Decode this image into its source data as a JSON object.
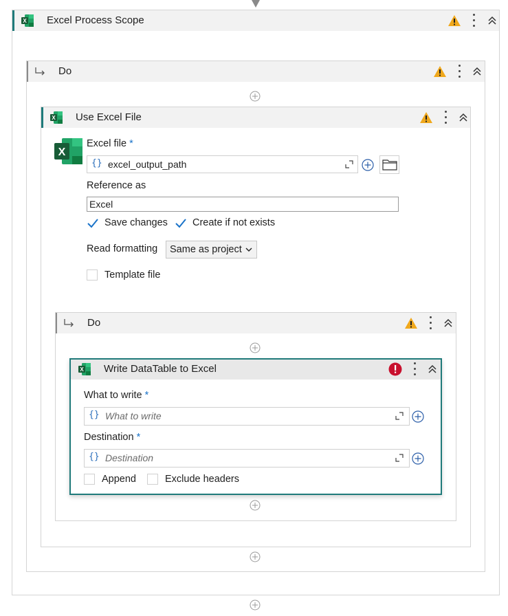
{
  "scope": {
    "title": "Excel Process Scope",
    "do_title": "Do"
  },
  "use_excel": {
    "title": "Use Excel File",
    "excel_file_label": "Excel file",
    "required_mark": "*",
    "excel_file_value": "excel_output_path",
    "reference_label": "Reference as",
    "reference_value": "Excel",
    "save_changes_label": "Save changes",
    "save_changes_checked": true,
    "create_if_not_exists_label": "Create if not exists",
    "create_if_not_exists_checked": true,
    "read_formatting_label": "Read formatting",
    "read_formatting_value": "Same as project",
    "template_file_label": "Template file",
    "template_file_checked": false,
    "do_title": "Do"
  },
  "write_table": {
    "title": "Write DataTable to Excel",
    "what_to_write_label": "What to write",
    "what_to_write_placeholder": "What to write",
    "destination_label": "Destination",
    "destination_placeholder": "Destination",
    "append_label": "Append",
    "append_checked": false,
    "exclude_headers_label": "Exclude headers",
    "exclude_headers_checked": false
  },
  "icons": {
    "braces": "{}",
    "warning": "warning-icon",
    "error": "error-icon",
    "excel": "excel-icon"
  },
  "colors": {
    "accent_teal": "#1f7a7a",
    "warning": "#f0a81c",
    "error": "#c8102e",
    "link_blue": "#1a73c9"
  }
}
